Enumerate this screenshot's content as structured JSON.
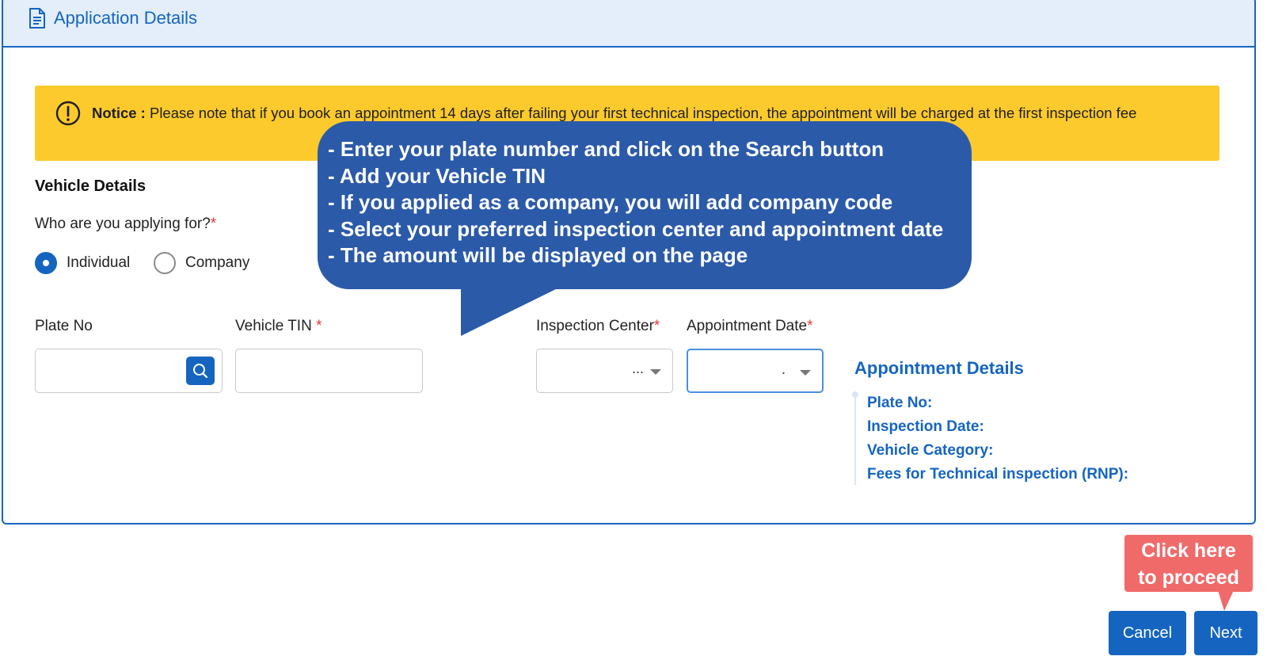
{
  "header": {
    "title": "Application Details",
    "icon": "document-icon"
  },
  "notice": {
    "label": "Notice :",
    "text": "Please note that if you book an appointment 14 days after failing your first technical inspection, the appointment will be charged at the first inspection fee"
  },
  "vehicle": {
    "section_title": "Vehicle Details",
    "question": "Who are you applying for?",
    "required_mark": "*",
    "options": [
      {
        "label": "Individual",
        "selected": true
      },
      {
        "label": "Company",
        "selected": false
      }
    ]
  },
  "fields": {
    "plate_label": "Plate No",
    "tin_label": "Vehicle TIN",
    "tin_required": "*",
    "center_label": "Inspection Center",
    "center_required": "*",
    "center_value": "...",
    "date_label": "Appointment Date",
    "date_required": "*",
    "date_value": "."
  },
  "appointment": {
    "title": "Appointment Details",
    "rows": [
      "Plate No:",
      "Inspection Date:",
      "Vehicle Category:",
      "Fees for Technical inspection (RNP):"
    ]
  },
  "buttons": {
    "cancel": "Cancel",
    "next": "Next"
  },
  "callout": {
    "lines": [
      "- Enter your plate number and click on the Search button",
      "- Add your Vehicle TIN",
      "- If  you applied as a company, you will add company code",
      "- Select your preferred inspection center and appointment date",
      "- The amount will be displayed on the page"
    ]
  },
  "proceed_callout": {
    "line1": "Click here",
    "line2": "to proceed"
  },
  "colors": {
    "primary": "#1565c0",
    "notice": "#fcca2c",
    "callout": "#2b5aa9",
    "proceed": "#f06a6a",
    "required": "#e53935"
  }
}
